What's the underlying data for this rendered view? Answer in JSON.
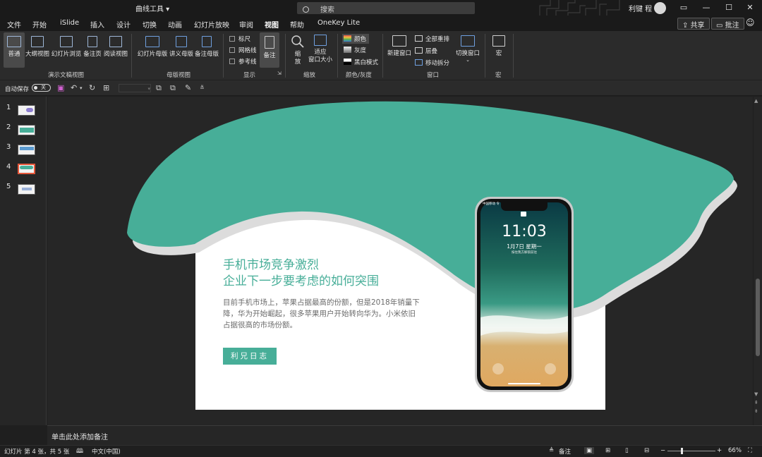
{
  "titlebar": {
    "doc_title": "曲线工具 ▾",
    "search_placeholder": "搜索",
    "user_name": "利键 程"
  },
  "menu": {
    "items": [
      "文件",
      "开始",
      "iSlide",
      "插入",
      "设计",
      "切换",
      "动画",
      "幻灯片放映",
      "审阅",
      "视图",
      "帮助",
      "OneKey Lite"
    ],
    "active": "视图",
    "share": "共享",
    "comment": "批注"
  },
  "ribbon": {
    "views": [
      "普通",
      "大纲视图",
      "幻灯片浏览",
      "备注页",
      "阅读视图"
    ],
    "views_group": "演示文稿视图",
    "masters": [
      "幻灯片母版",
      "讲义母版",
      "备注母版"
    ],
    "masters_group": "母版视图",
    "show_checks": [
      "标尺",
      "网格线",
      "参考线"
    ],
    "notes_btn": "备注",
    "show_group": "显示",
    "zoom_btn": "缩\n放",
    "fit_btn": "适应\n窗口大小",
    "zoom_group": "缩放",
    "color": "颜色",
    "gray": "灰度",
    "bw": "黑白模式",
    "color_group": "颜色/灰度",
    "new_window": "新建窗口",
    "arrange_all": "全部重排",
    "cascade": "层叠",
    "move_split": "移动拆分",
    "switch_window": "切换窗口",
    "window_group": "窗口",
    "macro": "宏",
    "macro_group": "宏"
  },
  "qat": {
    "autosave_label": "自动保存",
    "autosave_state": "关"
  },
  "slides": {
    "numbers": [
      "1",
      "2",
      "3",
      "4",
      "5"
    ],
    "active": "4"
  },
  "slide": {
    "title_line1": "手机市场竞争激烈",
    "title_line2": "企业下一步要考虑的如何突围",
    "body": "目前手机市场上，苹果占据最高的份额，但是2018年销量下降，华为开始崛起，很多苹果用户开始转向华为。小米依旧占据很高的市场份额。",
    "button": "利兄日志",
    "phone_time": "11:03",
    "phone_date": "1月7日 星期一",
    "phone_hint": "按住我方解锁前往",
    "phone_status": "中国移动 令"
  },
  "notes": {
    "placeholder": "单击此处添加备注"
  },
  "status": {
    "slide_info": "幻灯片 第 4 张，共 5 张",
    "language": "中文(中国)",
    "notes_btn": "备注",
    "zoom": "66%"
  },
  "colors": {
    "teal": "#47ae98",
    "slide_bg": "#ffffff",
    "shadow": "#dcdcdc",
    "app_bg": "#262626"
  }
}
